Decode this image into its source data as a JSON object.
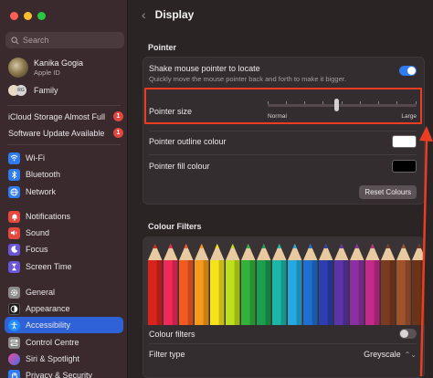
{
  "search": {
    "placeholder": "Search"
  },
  "user": {
    "name": "Kanika Gogia",
    "subtitle": "Apple ID"
  },
  "family": {
    "label": "Family",
    "initials": "RG"
  },
  "notices": [
    {
      "label": "iCloud Storage Almost Full",
      "badge": "1"
    },
    {
      "label": "Software Update Available",
      "badge": "1"
    }
  ],
  "sidebar": {
    "items": [
      {
        "label": "Wi-Fi",
        "icon": "wifi-icon",
        "color": "#2f7bf2"
      },
      {
        "label": "Bluetooth",
        "icon": "bluetooth-icon",
        "color": "#2f7bf2"
      },
      {
        "label": "Network",
        "icon": "globe-icon",
        "color": "#2f7bf2"
      },
      {
        "label": "Notifications",
        "icon": "bell-icon",
        "color": "#e5483f"
      },
      {
        "label": "Sound",
        "icon": "speaker-icon",
        "color": "#e5483f"
      },
      {
        "label": "Focus",
        "icon": "moon-icon",
        "color": "#6a56d8"
      },
      {
        "label": "Screen Time",
        "icon": "hourglass-icon",
        "color": "#6a56d8"
      },
      {
        "label": "General",
        "icon": "gear-icon",
        "color": "#8d8a8c"
      },
      {
        "label": "Appearance",
        "icon": "appearance-icon",
        "color": "#222"
      },
      {
        "label": "Accessibility",
        "icon": "accessibility-icon",
        "color": "#2f7bf2",
        "active": true
      },
      {
        "label": "Control Centre",
        "icon": "control-centre-icon",
        "color": "#8d8a8c"
      },
      {
        "label": "Siri & Spotlight",
        "icon": "siri-icon",
        "color": "#b24fd9"
      },
      {
        "label": "Privacy & Security",
        "icon": "hand-icon",
        "color": "#2f7bf2"
      }
    ]
  },
  "header": {
    "title": "Display"
  },
  "pointer": {
    "section_title": "Pointer",
    "shake_label": "Shake mouse pointer to locate",
    "shake_sub": "Quickly move the mouse pointer back and forth to make it bigger.",
    "shake_on": true,
    "size_label": "Pointer size",
    "size_min": "Normal",
    "size_max": "Large",
    "size_level": 0.46,
    "outline_label": "Pointer outline colour",
    "outline_color": "#ffffff",
    "fill_label": "Pointer fill colour",
    "fill_color": "#000000",
    "reset_label": "Reset Colours"
  },
  "filters": {
    "section_title": "Colour Filters",
    "filters_label": "Colour filters",
    "filters_on": false,
    "filter_type_label": "Filter type",
    "filter_type_value": "Greyscale"
  },
  "colors": {
    "accent": "#2f62d6",
    "highlight": "#ea3d24"
  }
}
